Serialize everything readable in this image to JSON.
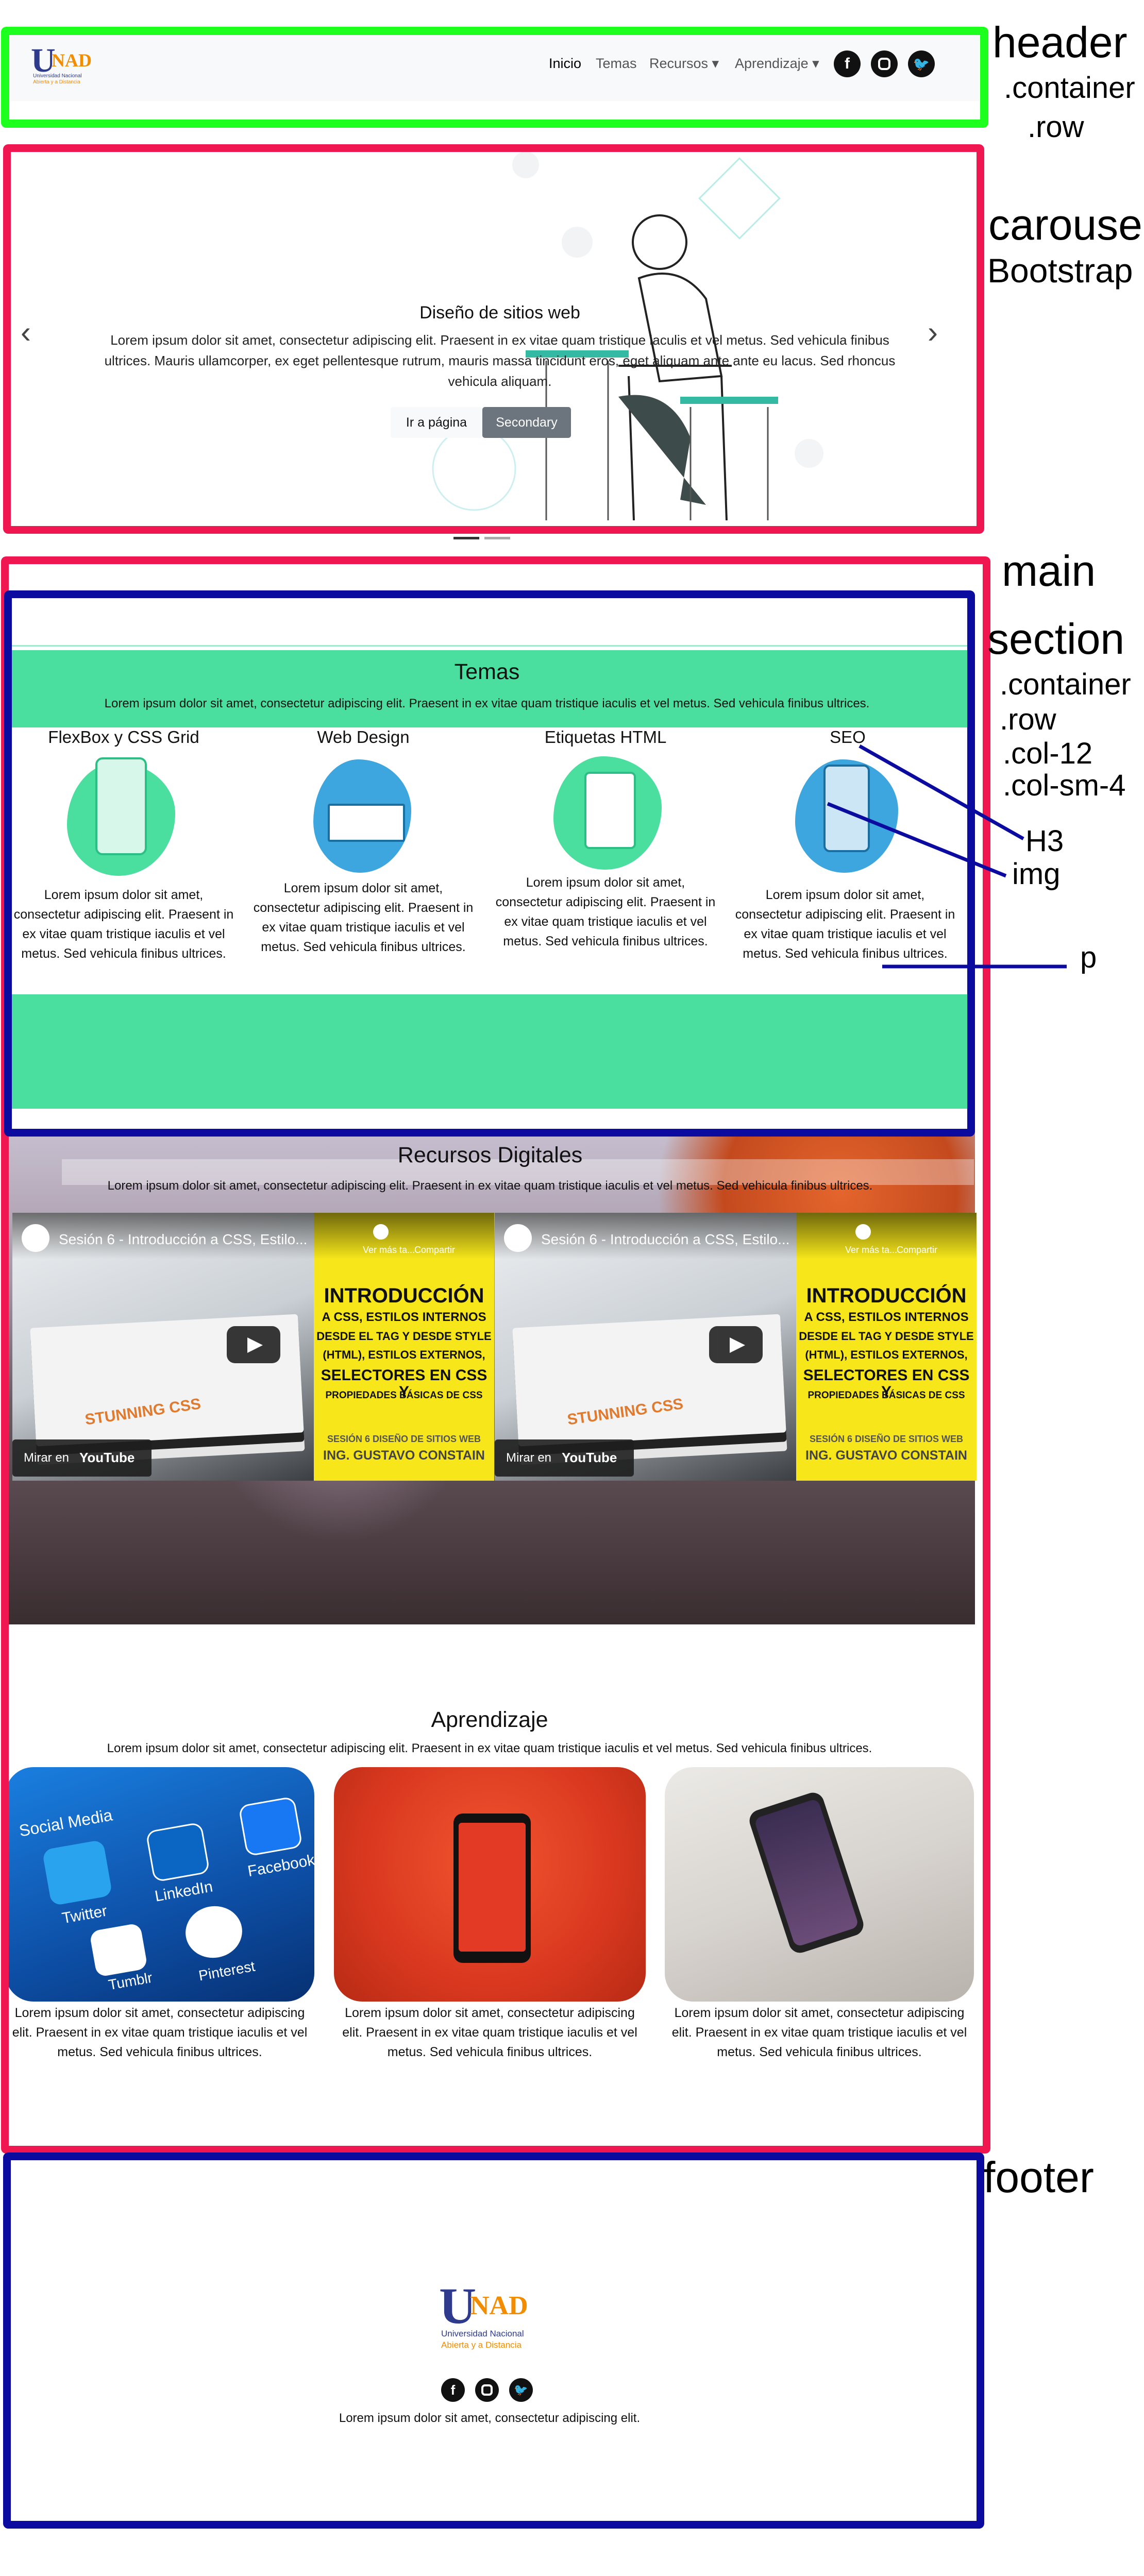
{
  "annotations": {
    "header": "header",
    "header_container": ".container",
    "header_row": ".row",
    "carousel": "carousel",
    "carousel_bootstrap": "Bootstrap",
    "main": "main",
    "section": "section",
    "section_container": ".container",
    "section_row": ".row",
    "col12": ".col-12",
    "colsm4": ".col-sm-4",
    "h3": "H3",
    "img": "img",
    "p": "p",
    "footer": "footer"
  },
  "header": {
    "logo_u": "U",
    "logo_nad": "NAD",
    "logo_sub1": "Universidad Nacional",
    "logo_sub2": "Abierta y a Distancia",
    "nav": [
      "Inicio",
      "Temas",
      "Recursos ▾",
      "Aprendizaje ▾"
    ],
    "social_icons": [
      "facebook-icon",
      "instagram-icon",
      "twitter-icon"
    ]
  },
  "carousel": {
    "title": "Diseño de sitios web",
    "text": "Lorem ipsum dolor sit amet, consectetur adipiscing elit. Praesent in ex vitae quam tristique iaculis et vel metus. Sed vehicula finibus ultrices. Mauris ullamcorper, ex eget pellentesque rutrum, mauris massa tincidunt eros, eget aliquam ante ante eu lacus. Sed rhoncus vehicula aliquam.",
    "btn_primary": "Ir a página",
    "btn_secondary": "Secondary",
    "prev_icon": "‹",
    "next_icon": "›"
  },
  "temas": {
    "title": "Temas",
    "subtitle": "Lorem ipsum dolor sit amet, consectetur adipiscing elit. Praesent in ex vitae quam tristique iaculis et vel metus. Sed vehicula finibus ultrices.",
    "cols": [
      {
        "title": "FlexBox y CSS Grid",
        "text": "Lorem ipsum dolor sit amet, consectetur adipiscing elit. Praesent in ex vitae quam tristique iaculis et vel metus. Sed vehicula finibus ultrices."
      },
      {
        "title": "Web Design",
        "text": "Lorem ipsum dolor sit amet, consectetur adipiscing elit. Praesent in ex vitae quam tristique iaculis et vel metus. Sed vehicula finibus ultrices."
      },
      {
        "title": "Etiquetas HTML",
        "text": "Lorem ipsum dolor sit amet, consectetur adipiscing elit. Praesent in ex vitae quam tristique iaculis et vel metus. Sed vehicula finibus ultrices."
      },
      {
        "title": "SEO",
        "text": "Lorem ipsum dolor sit amet, consectetur adipiscing elit. Praesent in ex vitae quam tristique iaculis et vel metus. Sed vehicula finibus ultrices."
      }
    ]
  },
  "recursos": {
    "title": "Recursos Digitales",
    "subtitle": "Lorem ipsum dolor sit amet, consectetur adipiscing elit. Praesent in ex vitae quam tristique iaculis et vel metus. Sed vehicula finibus ultrices.",
    "video_title": "Sesión 6 - Introducción a CSS, Estilo...",
    "watch_later": "Ver más ta...",
    "share": "Compartir",
    "watch_on": "Mirar en",
    "youtube": "YouTube",
    "y1": "INTRODUCCIÓN",
    "y2": "A CSS, ESTILOS INTERNOS",
    "y3": "DESDE EL TAG Y DESDE STYLE",
    "y4": "(HTML), ESTILOS EXTERNOS,",
    "y5": "SELECTORES EN CSS Y",
    "y6": "PROPIEDADES BÁSICAS DE CSS",
    "y7": "SESIÓN 6 DISEÑO DE SITIOS WEB",
    "y8": "ING. GUSTAVO CONSTAIN",
    "book_text": "STUNNING CSS"
  },
  "aprendizaje": {
    "title": "Aprendizaje",
    "subtitle": "Lorem ipsum dolor sit amet, consectetur adipiscing elit. Praesent in ex vitae quam tristique iaculis et vel metus. Sed vehicula finibus ultrices.",
    "card_text": "Lorem ipsum dolor sit amet, consectetur adipiscing elit. Praesent in ex vitae quam tristique iaculis et vel metus. Sed vehicula finibus ultrices.",
    "social_labels": [
      "Social Media",
      "Twitter",
      "LinkedIn",
      "Facebook",
      "Tumblr",
      "Pinterest"
    ]
  },
  "footer": {
    "text": "Lorem ipsum dolor sit amet, consectetur adipiscing elit."
  },
  "colors": {
    "header_frame": "#1dff1d",
    "carousel_frame": "#f0164f",
    "section_frame": "#0b0ba0",
    "mint": "#4ade9f",
    "blue_blob": "#3ea6de",
    "dark_btn": "#6c757d"
  }
}
